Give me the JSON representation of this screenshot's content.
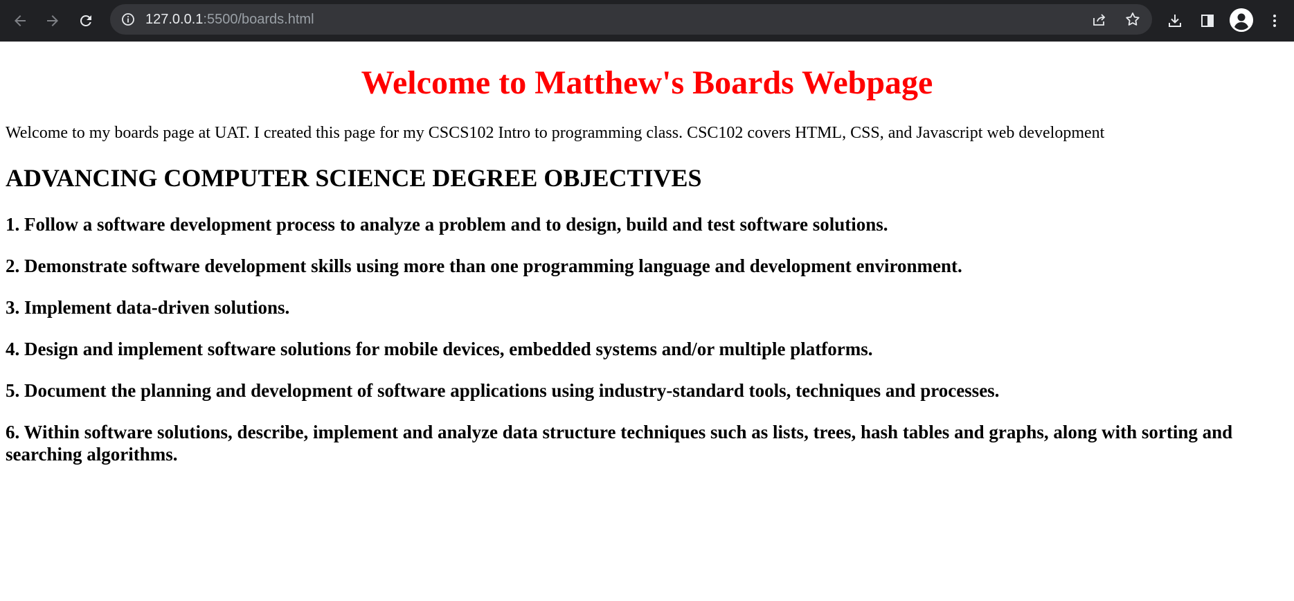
{
  "browser": {
    "url_host": "127.0.0.1",
    "url_rest": ":5500/boards.html",
    "icons": {
      "back": "back-arrow-icon",
      "forward": "forward-arrow-icon",
      "reload": "reload-icon",
      "site_info": "info-icon",
      "share": "share-icon",
      "bookmark": "star-icon",
      "download": "download-icon",
      "side_panel": "side-panel-icon",
      "profile": "profile-avatar-icon",
      "menu": "kebab-menu-icon"
    },
    "colors": {
      "toolbar_bg": "#202124",
      "omnibox_bg": "#35363a",
      "icon": "#e8eaed",
      "icon_disabled": "#7f8186"
    }
  },
  "page": {
    "title": "Welcome to Matthew's Boards Webpage",
    "title_color": "#ff0000",
    "intro": "Welcome to my boards page at UAT. I created this page for my CSCS102 Intro to programming class. CSC102 covers HTML, CSS, and Javascript web development",
    "section_heading": "ADVANCING COMPUTER SCIENCE DEGREE OBJECTIVES",
    "objectives": [
      "1. Follow a software development process to analyze a problem and to design, build and test software solutions.",
      "2. Demonstrate software development skills using more than one programming language and development environment.",
      "3. Implement data-driven solutions.",
      "4. Design and implement software solutions for mobile devices, embedded systems and/or multiple platforms.",
      "5. Document the planning and development of software applications using industry-standard tools, techniques and processes.",
      "6. Within software solutions, describe, implement and analyze data structure techniques such as lists, trees, hash tables and graphs, along with sorting and searching algorithms."
    ]
  }
}
